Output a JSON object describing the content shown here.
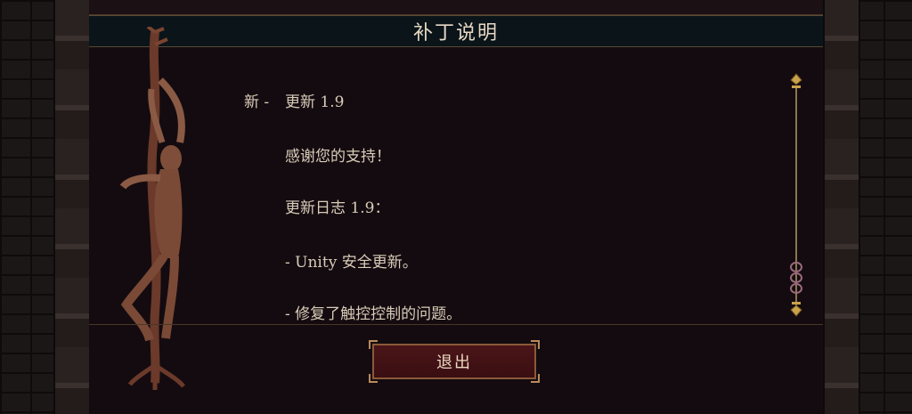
{
  "dialog": {
    "title": "补丁说明"
  },
  "notes": {
    "tag": "新 -",
    "lines": [
      "更新 1.9",
      "感谢您的支持！",
      "更新日志 1.9：",
      "- Unity 安全更新。",
      "- 修复了触控控制的问题。"
    ]
  },
  "buttons": {
    "exit_label": "退出"
  },
  "colors": {
    "panel_bg": "#140b10",
    "title_bar_bg": "#0a1419",
    "text": "#d9ccb8",
    "button_bg": "#4b1518",
    "accent_gold": "#c9a24a"
  },
  "icons": {
    "statue": "hanging-figure-statue",
    "scroll_up": "ornate-scroll-cap-icon",
    "scroll_thumb": "ornate-scroll-thumb-icon"
  }
}
